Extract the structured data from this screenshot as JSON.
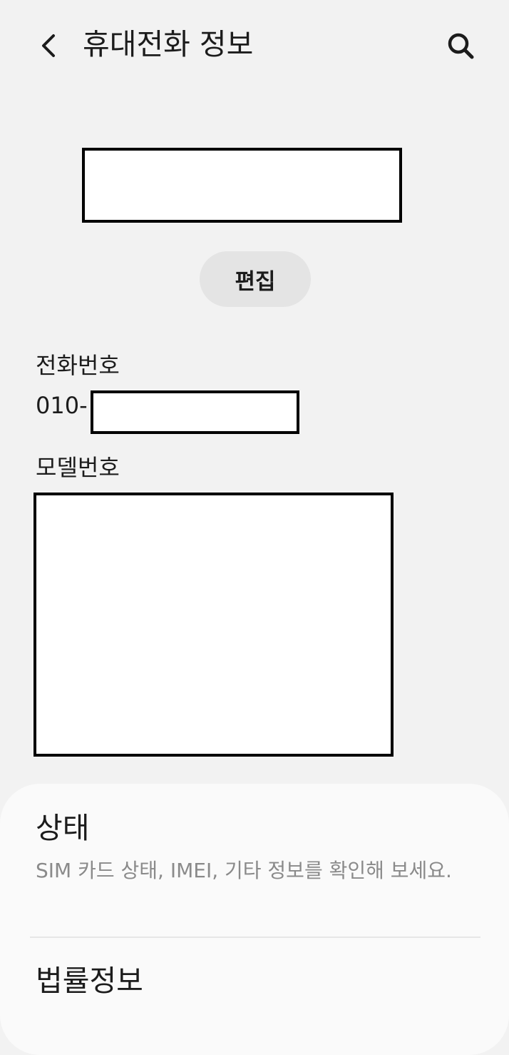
{
  "header": {
    "title": "휴대전화 정보",
    "back_icon": "chevron-left-icon",
    "search_icon": "search-icon"
  },
  "profile": {
    "edit_label": "편집"
  },
  "phone": {
    "label": "전화번호",
    "value_prefix": "010-"
  },
  "model": {
    "label": "모델번호"
  },
  "menu": {
    "status": {
      "title": "상태",
      "subtitle": "SIM 카드 상태, IMEI, 기타 정보를 확인해 보세요."
    },
    "legal": {
      "title": "법률정보"
    }
  },
  "colors": {
    "background": "#f2f2f2",
    "card": "#fafafa",
    "edit_button": "#e4e4e4",
    "subtitle_text": "#8a8a8a",
    "redaction_fill": "#ffffff",
    "redaction_border": "#000000"
  }
}
